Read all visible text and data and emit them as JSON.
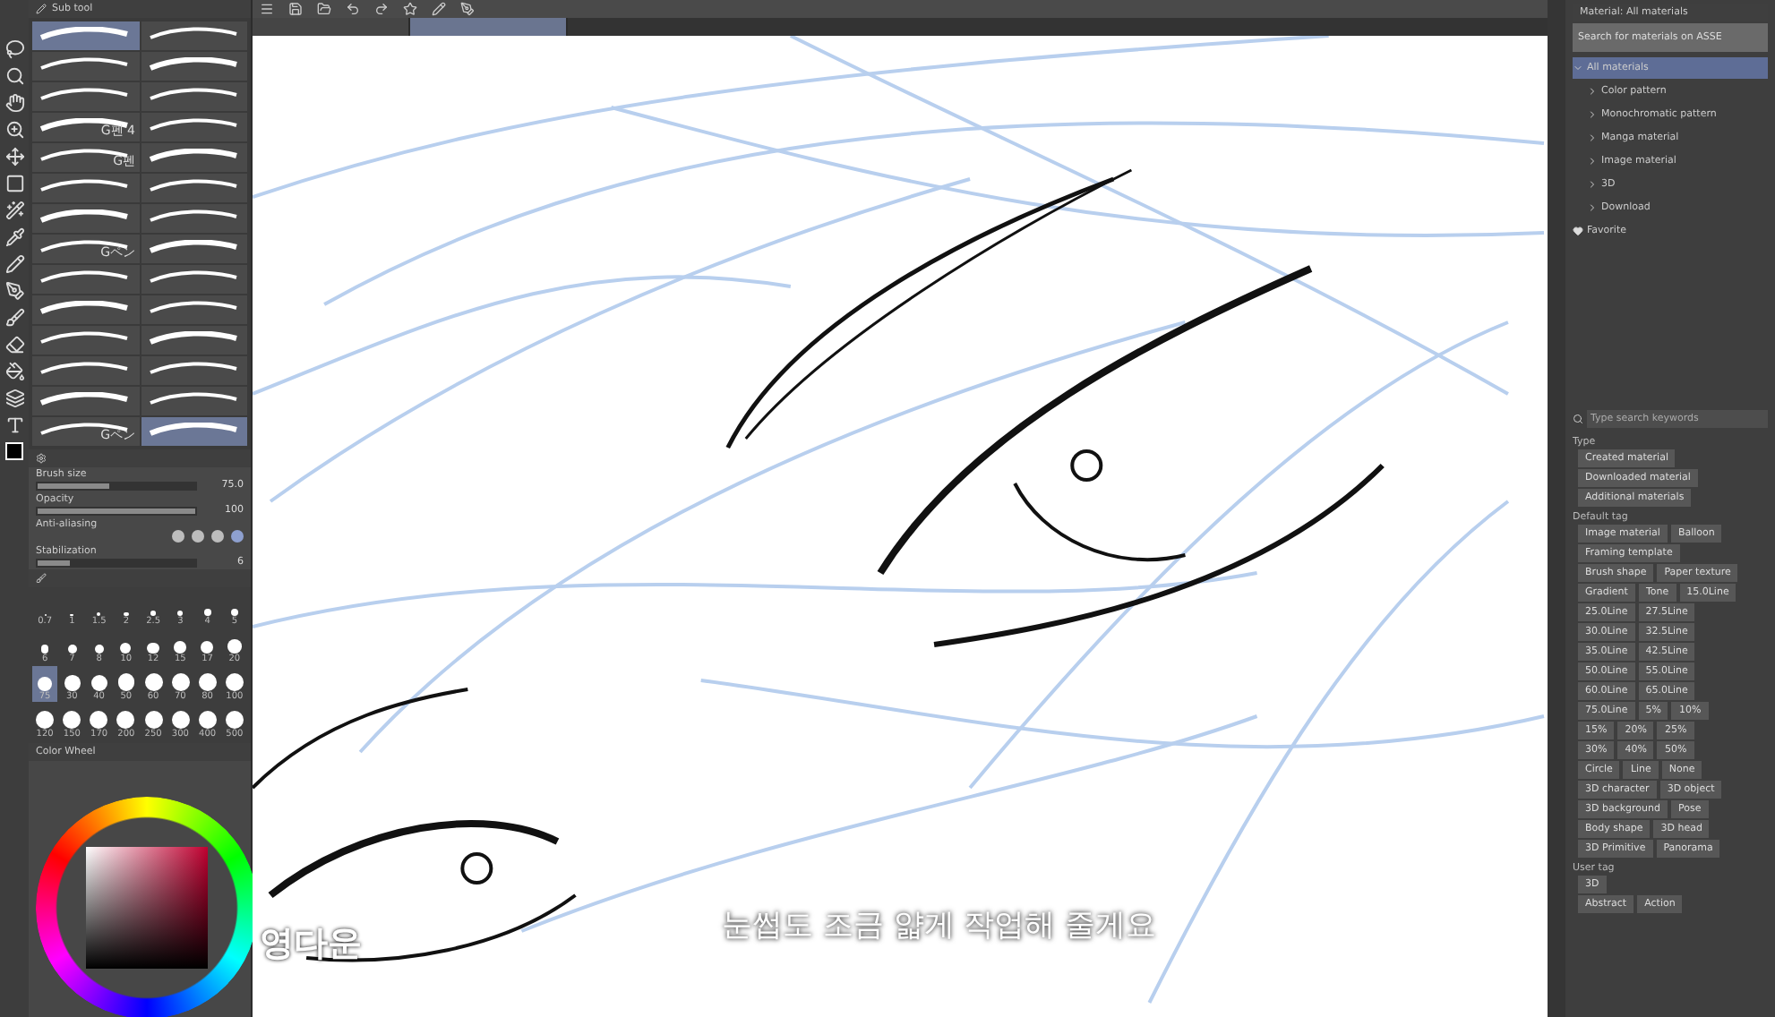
{
  "doc_tabs": [
    {
      "selected": false
    },
    {
      "selected": true
    }
  ],
  "sub_tool": {
    "title": "Sub tool"
  },
  "brushes": [
    {
      "selected": true
    },
    {
      "selected": false
    },
    {
      "selected": false
    },
    {
      "selected": false
    },
    {
      "selected": false
    },
    {
      "selected": false
    },
    {
      "name": "G펜 4",
      "selected": false
    },
    {
      "selected": false
    },
    {
      "name": "G펜",
      "selected": false
    },
    {
      "selected": false
    },
    {
      "selected": false
    },
    {
      "selected": false
    },
    {
      "selected": false
    },
    {
      "selected": false
    },
    {
      "name": "Gペン",
      "selected": false
    },
    {
      "selected": false
    },
    {
      "selected": false
    },
    {
      "selected": false
    },
    {
      "selected": false
    },
    {
      "selected": false
    },
    {
      "selected": false
    },
    {
      "selected": false
    },
    {
      "selected": false
    },
    {
      "selected": false
    },
    {
      "selected": false
    },
    {
      "selected": false
    },
    {
      "name": "Gペン",
      "selected": false
    },
    {
      "selected": true
    }
  ],
  "tool_property": {
    "properties": [
      {
        "kind": "slider",
        "label": "Brush size",
        "value": "75.0",
        "level": 0.45
      },
      {
        "kind": "slider",
        "label": "Opacity",
        "value": "100",
        "level": 1
      },
      {
        "kind": "dots",
        "label": "Anti-aliasing",
        "options": [
          {
            "selected": false
          },
          {
            "selected": false
          },
          {
            "selected": false
          },
          {
            "selected": true
          }
        ]
      },
      {
        "kind": "slider",
        "label": "Stabilization",
        "value": "6",
        "level": 0.2
      }
    ]
  },
  "brush_sizes": [
    {
      "label": "0.7",
      "selected": false
    },
    {
      "label": "1",
      "selected": false
    },
    {
      "label": "1.5",
      "selected": false
    },
    {
      "label": "2",
      "selected": false
    },
    {
      "label": "2.5",
      "selected": false
    },
    {
      "label": "3",
      "selected": false
    },
    {
      "label": "4",
      "selected": false
    },
    {
      "label": "5",
      "selected": false
    },
    {
      "label": "6",
      "selected": false
    },
    {
      "label": "7",
      "selected": false
    },
    {
      "label": "8",
      "selected": false
    },
    {
      "label": "10",
      "selected": false
    },
    {
      "label": "12",
      "selected": false
    },
    {
      "label": "15",
      "selected": false
    },
    {
      "label": "17",
      "selected": false
    },
    {
      "label": "20",
      "selected": false
    },
    {
      "label": "75",
      "selected": true
    },
    {
      "label": "30",
      "selected": false
    },
    {
      "label": "40",
      "selected": false
    },
    {
      "label": "50",
      "selected": false
    },
    {
      "label": "60",
      "selected": false
    },
    {
      "label": "70",
      "selected": false
    },
    {
      "label": "80",
      "selected": false
    },
    {
      "label": "100",
      "selected": false
    },
    {
      "label": "120",
      "selected": false
    },
    {
      "label": "150",
      "selected": false
    },
    {
      "label": "170",
      "selected": false
    },
    {
      "label": "200",
      "selected": false
    },
    {
      "label": "250",
      "selected": false
    },
    {
      "label": "300",
      "selected": false
    },
    {
      "label": "400",
      "selected": false
    },
    {
      "label": "500",
      "selected": false
    }
  ],
  "color_wheel": {
    "title": "Color Wheel"
  },
  "material": {
    "title": "Material: All materials",
    "assets_search": "Search for materials on ASSE",
    "tree": [
      {
        "label": "All materials",
        "expanded": true,
        "selected": true,
        "children": [
          {
            "label": "Color pattern"
          },
          {
            "label": "Monochromatic pattern"
          },
          {
            "label": "Manga material"
          },
          {
            "label": "Image material"
          },
          {
            "label": "3D"
          },
          {
            "label": "Download"
          }
        ]
      },
      {
        "label": "Favorite",
        "selected": false
      }
    ],
    "search_placeholder": "Type search keywords",
    "tag_groups": [
      {
        "title": "Type",
        "tags": [
          [
            "Created material"
          ],
          [
            "Downloaded material"
          ],
          [
            "Additional materials"
          ]
        ]
      },
      {
        "title": "Default tag",
        "tags": [
          [
            "Image material",
            "Balloon"
          ],
          [
            "Framing template"
          ],
          [
            "Brush shape",
            "Paper texture"
          ],
          [
            "Gradient",
            "Tone",
            "15.0Line"
          ],
          [
            "25.0Line",
            "27.5Line"
          ],
          [
            "30.0Line",
            "32.5Line"
          ],
          [
            "35.0Line",
            "42.5Line"
          ],
          [
            "50.0Line",
            "55.0Line"
          ],
          [
            "60.0Line",
            "65.0Line"
          ],
          [
            "75.0Line",
            "5%",
            "10%"
          ],
          [
            "15%",
            "20%",
            "25%"
          ],
          [
            "30%",
            "40%",
            "50%"
          ],
          [
            "Circle",
            "Line",
            "None"
          ],
          [
            "3D character",
            "3D object"
          ],
          [
            "3D background",
            "Pose"
          ],
          [
            "Body shape",
            "3D head"
          ],
          [
            "3D Primitive",
            "Panorama"
          ]
        ]
      },
      {
        "title": "User tag",
        "tags": [
          [
            "3D"
          ],
          [
            "Abstract",
            "Action"
          ]
        ]
      }
    ]
  },
  "subtitle": "눈썹도 조금 얇게 작업해 줄게요",
  "channel_name": "영다운"
}
